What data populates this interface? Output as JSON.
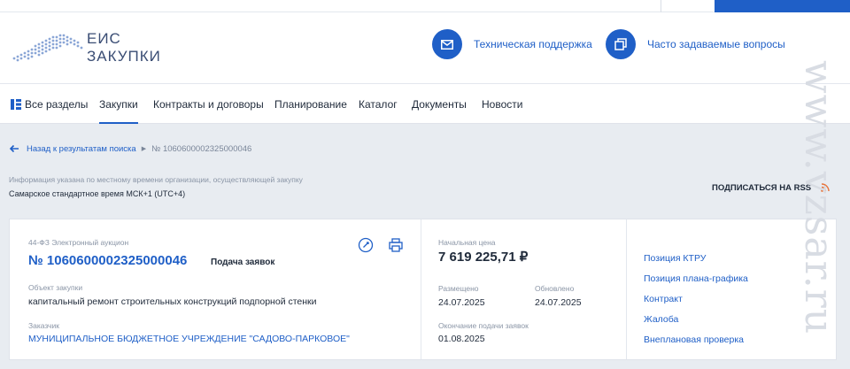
{
  "logo": {
    "line1": "ЕИС",
    "line2": "ЗАКУПКИ"
  },
  "header_links": [
    {
      "label": "Техническая поддержка",
      "icon": "mail-icon"
    },
    {
      "label": "Часто задаваемые вопросы",
      "icon": "copy-icon"
    }
  ],
  "nav": {
    "all_sections": "Все разделы",
    "items": [
      "Закупки",
      "Контракты и договоры",
      "Планирование",
      "Каталог",
      "Документы",
      "Новости"
    ],
    "active": "Закупки"
  },
  "breadcrumb": {
    "back_label": "Назад к результатам поиска",
    "current": "№ 1060600002325000046"
  },
  "timezone": {
    "info": "Информация указана по местному времени организации, осуществляющей закупку",
    "value": "Самарское стандартное время МСК+1 (UTC+4)"
  },
  "rss_label": "ПОДПИСАТЬСЯ НА RSS",
  "procurement": {
    "type": "44-ФЗ Электронный аукцион",
    "number": "№ 1060600002325000046",
    "stage": "Подача заявок",
    "object_label": "Объект закупки",
    "object_value": "капитальный ремонт строительных конструкций подпорной стенки",
    "customer_label": "Заказчик",
    "customer_value": "МУНИЦИПАЛЬНОЕ БЮДЖЕТНОЕ УЧРЕЖДЕНИЕ \"САДОВО-ПАРКОВОЕ\"",
    "price_label": "Начальная цена",
    "price_value": "7 619 225,71 ₽",
    "published_label": "Размещено",
    "published_value": "24.07.2025",
    "updated_label": "Обновлено",
    "updated_value": "24.07.2025",
    "deadline_label": "Окончание подачи заявок",
    "deadline_value": "01.08.2025"
  },
  "side_links": [
    "Позиция КТРУ",
    "Позиция плана-графика",
    "Контракт",
    "Жалоба",
    "Внеплановая проверка"
  ],
  "watermark": "www.vzsar.ru",
  "colors": {
    "accent": "#1f5fc7",
    "background": "#e8ecf1",
    "rss": "#e8733a"
  }
}
